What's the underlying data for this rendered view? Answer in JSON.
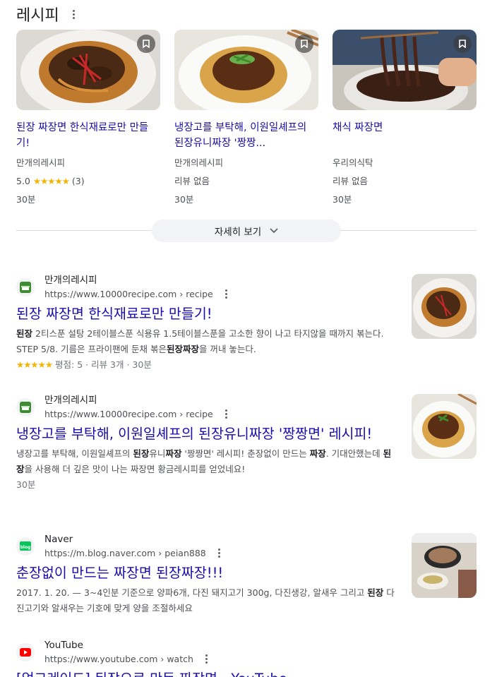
{
  "section": {
    "title": "레시피"
  },
  "cards": [
    {
      "title": "된장 짜장면 한식재료로만 만들기!",
      "source": "만개의레시피",
      "rating_value": "5.0",
      "stars": "★★★★★",
      "rating_count": "(3)",
      "time": "30분"
    },
    {
      "title": "냉장고를 부탁해, 이원일셰프의 된장유니짜장 '짱짱...",
      "source": "만개의레시피",
      "reviews": "리뷰 없음",
      "time": "30분"
    },
    {
      "title": "채식 짜장면",
      "source": "우리의식탁",
      "reviews": "리뷰 없음",
      "time": "30분"
    }
  ],
  "more_button": {
    "label": "자세히 보기"
  },
  "results": [
    {
      "site": "만개의레시피",
      "url": "https://www.10000recipe.com › recipe",
      "title": "된장 짜장면 한식재료로만 만들기!",
      "snippet": [
        {
          "text": "된장",
          "bold": true
        },
        {
          "text": " 2티스푼 설탕 2테이블스푼 식용유 1.5테이블스푼을 고소한 향이 나고 타지않을 때까지 볶는다. STEP 5/8. 기름은 프라이팬에 둔채 볶은",
          "bold": false
        },
        {
          "text": "된장짜장",
          "bold": true
        },
        {
          "text": "을 꺼내 놓는다.",
          "bold": false
        }
      ],
      "stars": "★★★★★",
      "rating": "평점: 5 · 리뷰 3개 · 30분",
      "favicon": "10000recipe-icon"
    },
    {
      "site": "만개의레시피",
      "url": "https://www.10000recipe.com › recipe",
      "title": "냉장고를 부탁해, 이원일셰프의 된장유니짜장 '짱짱면' 레시피!",
      "snippet": [
        {
          "text": "냉장고를 부탁해, 이원일셰프의 ",
          "bold": false
        },
        {
          "text": "된장",
          "bold": true
        },
        {
          "text": "유니",
          "bold": false
        },
        {
          "text": "짜장",
          "bold": true
        },
        {
          "text": " '짱짱면' 레시피! 춘장없이 만드는 ",
          "bold": false
        },
        {
          "text": "짜장",
          "bold": true
        },
        {
          "text": ". 기대안했는데 ",
          "bold": false
        },
        {
          "text": "된장",
          "bold": true
        },
        {
          "text": "을 사용해 더 깊은 맛이 나는 짜장면 황금레시피를 얻었네요!",
          "bold": false
        }
      ],
      "rating": "30분",
      "favicon": "10000recipe-icon"
    },
    {
      "site": "Naver",
      "url": "https://m.blog.naver.com › peian888",
      "title": "춘장없이 만드는 짜장면 된장짜장!!!",
      "snippet": [
        {
          "text": "2017. 1. 20. — 3~4인분 기준으로 양파6개, 다진 돼지고기 300g, 다진생강, 알새우 그리고 ",
          "bold": false
        },
        {
          "text": "된장",
          "bold": true
        },
        {
          "text": " 다진고기와 알새우는 기호에 맞게 양을 조절하세요",
          "bold": false
        }
      ],
      "favicon": "naver-blog-icon"
    },
    {
      "site": "YouTube",
      "url": "https://www.youtube.com › watch",
      "title": "[업그레이드] 된장으로 만든 짜장면 - YouTube",
      "favicon": "youtube-icon"
    }
  ],
  "colors": {
    "link": "#1a0dab",
    "star": "#f4b400",
    "naver": "#03c75a",
    "youtube": "#ff0000"
  }
}
